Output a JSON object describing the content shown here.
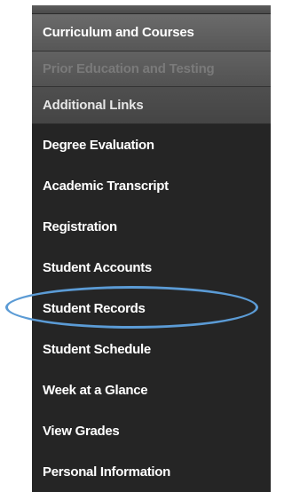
{
  "menu": {
    "sections": [
      {
        "label": ""
      },
      {
        "label": "Curriculum and Courses"
      },
      {
        "label": "Prior Education and Testing"
      },
      {
        "label": "Additional Links"
      }
    ],
    "links": [
      {
        "label": "Degree Evaluation"
      },
      {
        "label": "Academic Transcript"
      },
      {
        "label": "Registration"
      },
      {
        "label": "Student Accounts"
      },
      {
        "label": "Student Records"
      },
      {
        "label": "Student Schedule"
      },
      {
        "label": "Week at a Glance"
      },
      {
        "label": "View Grades"
      },
      {
        "label": "Personal Information"
      }
    ]
  },
  "annotation": {
    "highlighted_item": "Student Records",
    "color": "#5b9bd5"
  }
}
